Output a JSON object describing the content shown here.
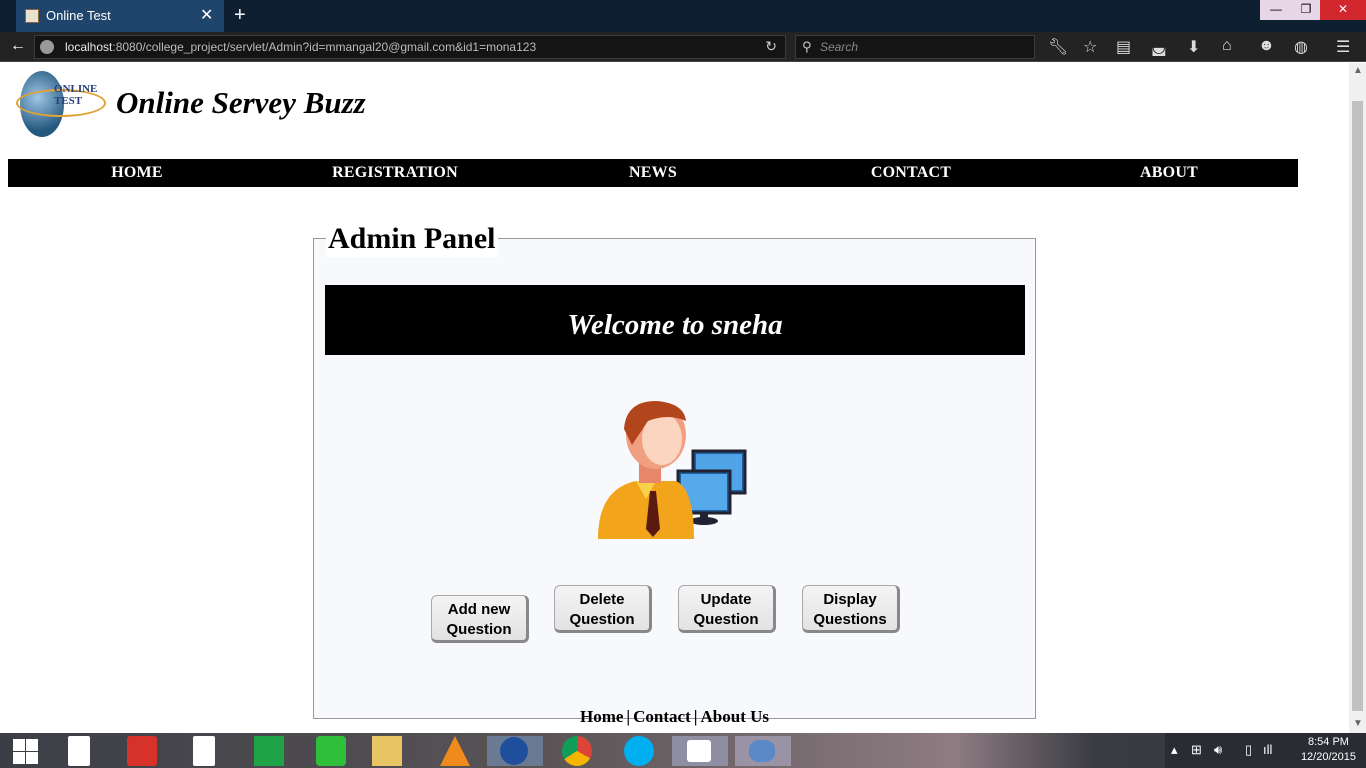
{
  "browser": {
    "tab_title": "Online Test",
    "url_host": "localhost",
    "url_rest": ":8080/college_project/servlet/Admin?id=mmangal20@gmail.com&id1=mona123",
    "search_placeholder": "Search"
  },
  "site": {
    "logo_text": "ONLINE TEST",
    "title": "Online Servey Buzz"
  },
  "nav": [
    "HOME",
    "REGISTRATION",
    "NEWS",
    "CONTACT",
    "ABOUT"
  ],
  "panel": {
    "legend": "Admin Panel",
    "welcome": "Welcome to sneha",
    "buttons": [
      {
        "line1": "Add new",
        "line2": "Question"
      },
      {
        "line1": "Delete",
        "line2": "Question"
      },
      {
        "line1": "Update",
        "line2": "Question"
      },
      {
        "line1": "Display",
        "line2": "Questions"
      }
    ]
  },
  "footer": {
    "home": "Home",
    "contact": "Contact",
    "about": "About Us",
    "separator": "|"
  },
  "taskbar": {
    "time": "8:54 PM",
    "date": "12/20/2015"
  },
  "colors": {
    "nav_bg": "#000000",
    "tab_active": "#20456d",
    "close_button": "#d2272c"
  }
}
